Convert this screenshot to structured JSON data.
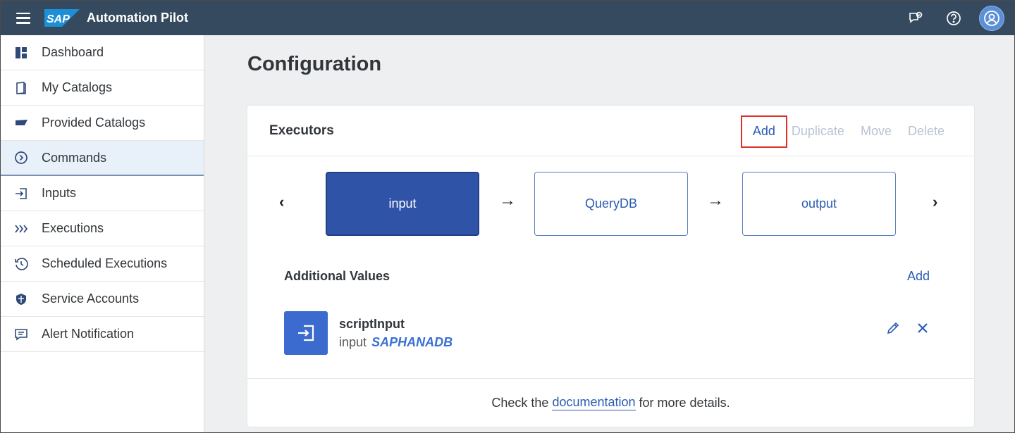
{
  "shell": {
    "logo_text": "SAP",
    "app_title": "Automation Pilot",
    "icons": [
      "menu-icon",
      "feedback-icon",
      "help-icon",
      "user-avatar-icon"
    ]
  },
  "sidebar": {
    "items": [
      {
        "label": "Dashboard",
        "icon": "dashboard-icon"
      },
      {
        "label": "My Catalogs",
        "icon": "catalog-icon"
      },
      {
        "label": "Provided Catalogs",
        "icon": "provided-catalog-icon"
      },
      {
        "label": "Commands",
        "icon": "command-icon",
        "active": true
      },
      {
        "label": "Inputs",
        "icon": "input-icon"
      },
      {
        "label": "Executions",
        "icon": "executions-icon"
      },
      {
        "label": "Scheduled Executions",
        "icon": "scheduled-icon"
      },
      {
        "label": "Service Accounts",
        "icon": "shield-icon"
      },
      {
        "label": "Alert Notification",
        "icon": "alert-icon"
      }
    ]
  },
  "main": {
    "title": "Configuration",
    "executors": {
      "title": "Executors",
      "toolbar": {
        "add": "Add",
        "duplicate": "Duplicate",
        "move": "Move",
        "delete": "Delete"
      },
      "steps": [
        {
          "label": "input",
          "selected": true
        },
        {
          "label": "QueryDB"
        },
        {
          "label": "output"
        }
      ],
      "nav": {
        "prev": "‹",
        "next": "›",
        "connector": "→"
      }
    },
    "additional_values": {
      "title": "Additional Values",
      "add_label": "Add",
      "items": [
        {
          "name": "scriptInput",
          "type": "input",
          "ref": "SAPHANADB"
        }
      ]
    },
    "footer": {
      "prefix": "Check the",
      "link": "documentation",
      "suffix": "for more details."
    }
  },
  "colors": {
    "shellbar": "#354a5f",
    "accent": "#2a5bb0",
    "selected_step": "#2f53a6",
    "highlight": "#e0302a"
  }
}
